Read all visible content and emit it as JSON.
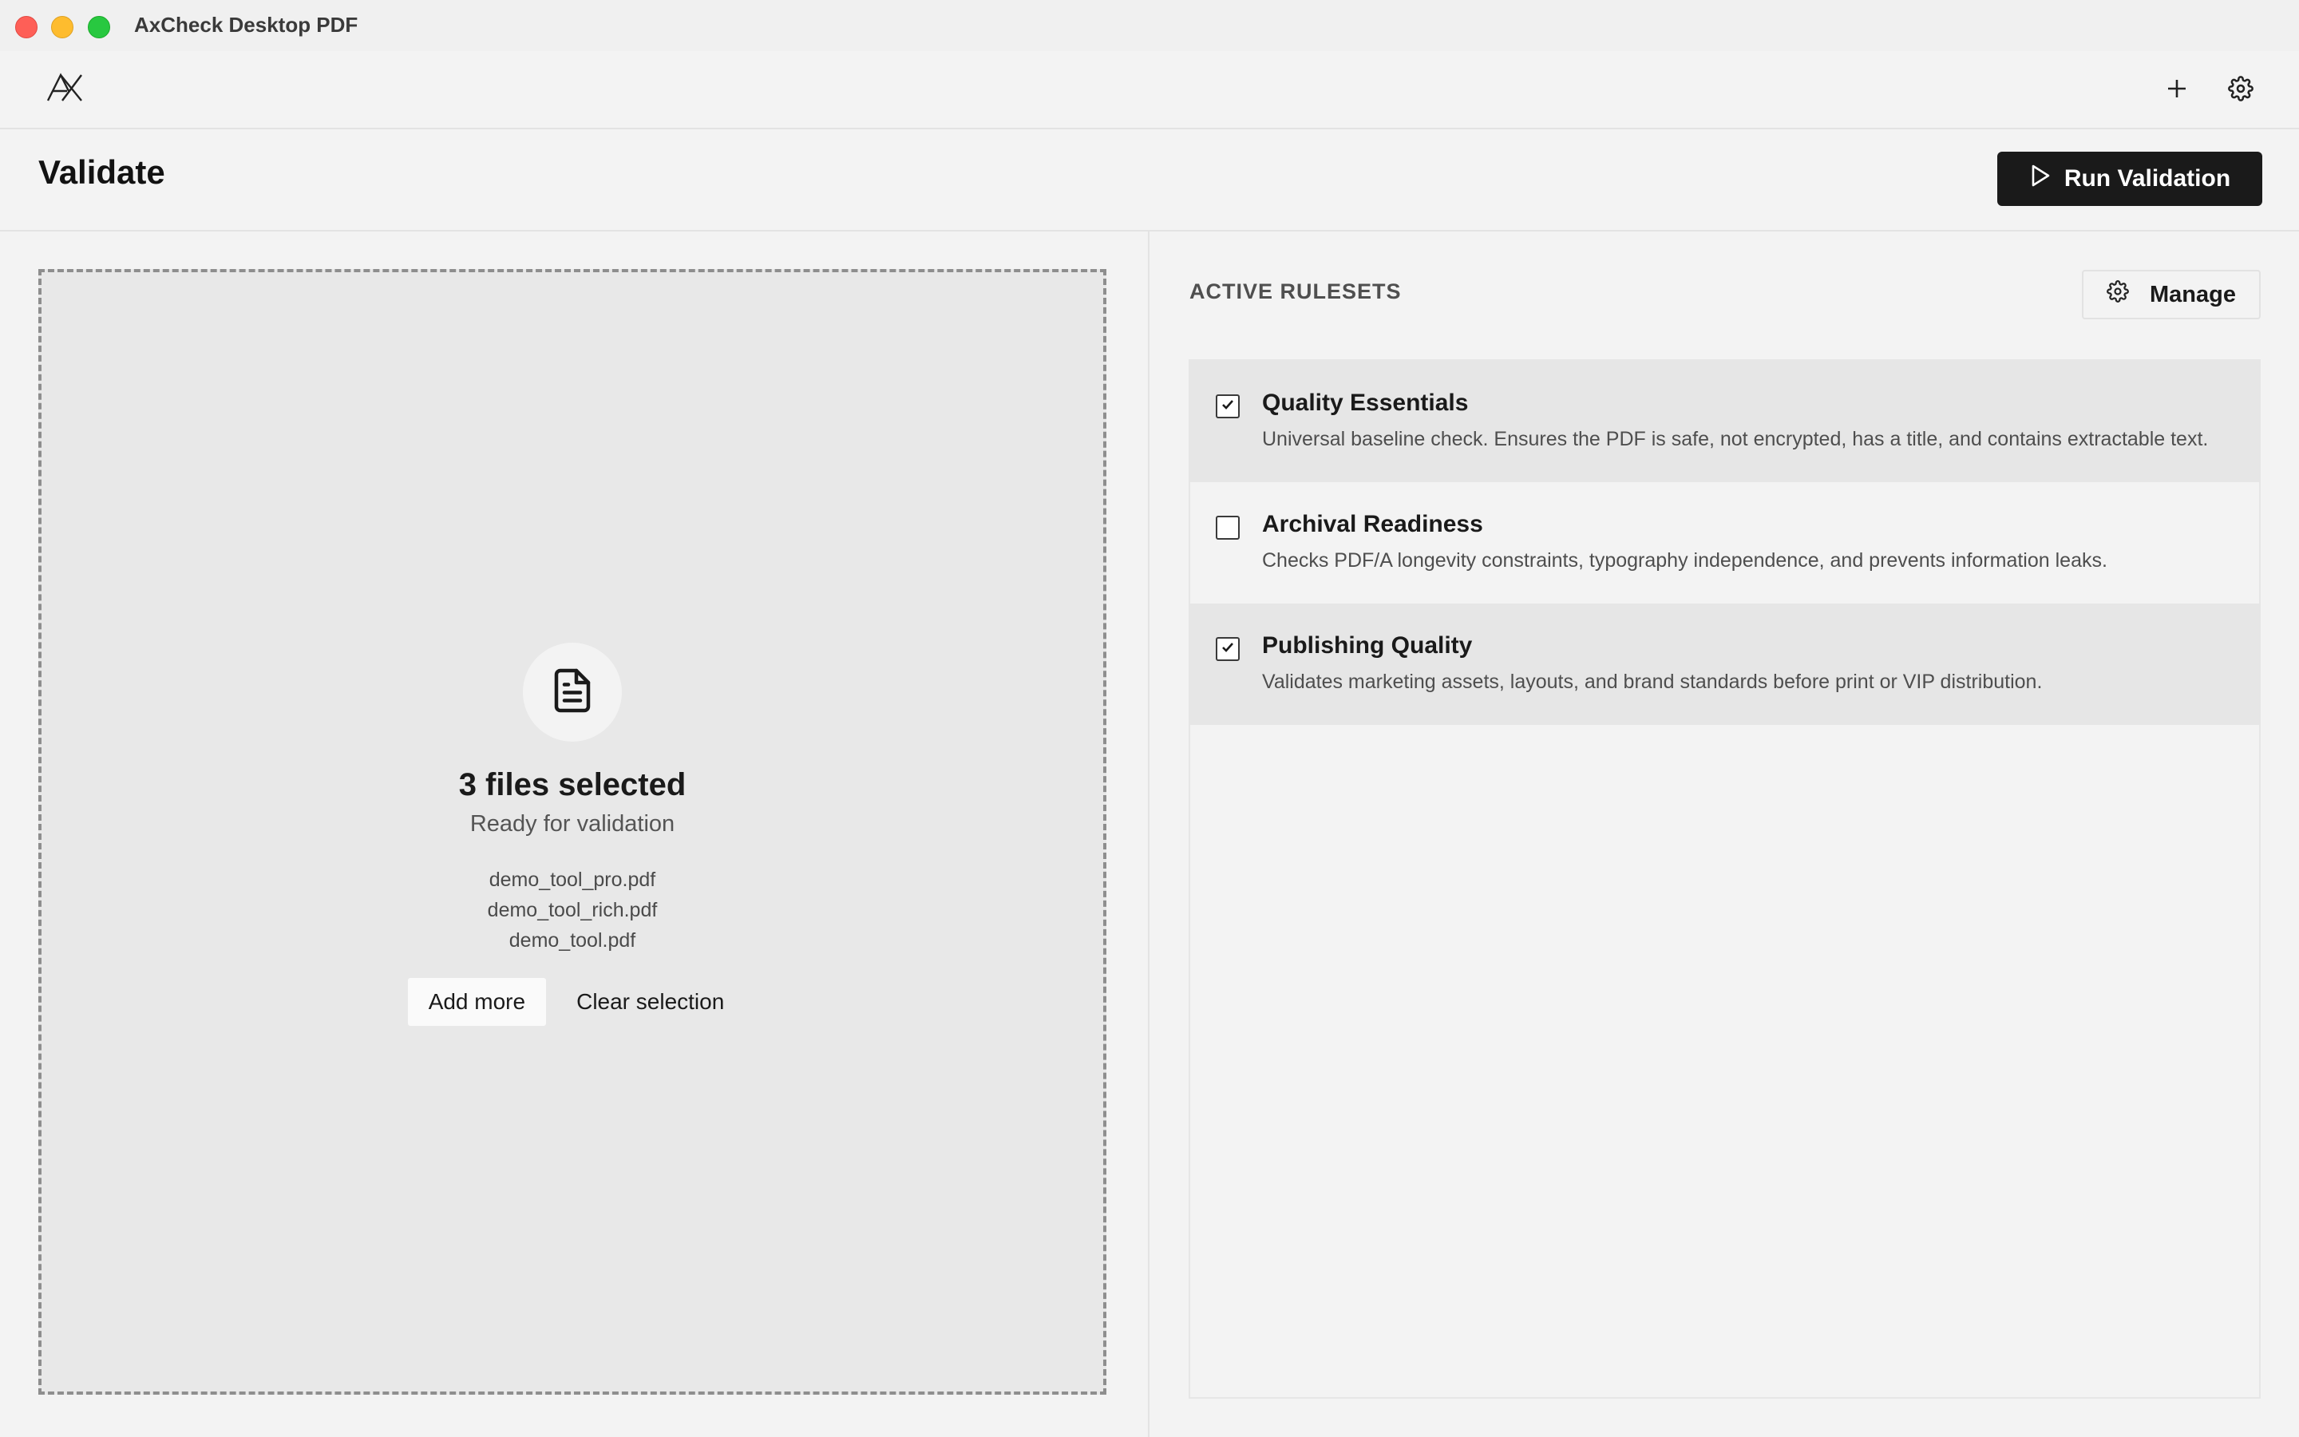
{
  "window": {
    "title": "AxCheck Desktop PDF"
  },
  "toolbar": {
    "logo_icon": "ax-logo-icon",
    "add_icon": "plus-icon",
    "settings_icon": "gear-icon"
  },
  "header": {
    "title": "Validate",
    "run_button_label": "Run Validation"
  },
  "dropzone": {
    "title": "3 files selected",
    "subtitle": "Ready for validation",
    "files": [
      "demo_tool_pro.pdf",
      "demo_tool_rich.pdf",
      "demo_tool.pdf"
    ],
    "add_more_label": "Add more",
    "clear_label": "Clear selection"
  },
  "rulesets": {
    "heading": "ACTIVE RULESETS",
    "manage_label": "Manage",
    "items": [
      {
        "name": "Quality Essentials",
        "description": "Universal baseline check. Ensures the PDF is safe, not encrypted, has a title, and contains extractable text.",
        "checked": true
      },
      {
        "name": "Archival Readiness",
        "description": "Checks PDF/A longevity constraints, typography independence, and prevents information leaks.",
        "checked": false
      },
      {
        "name": "Publishing Quality",
        "description": "Validates marketing assets, layouts, and brand standards before print or VIP distribution.",
        "checked": true
      }
    ]
  }
}
